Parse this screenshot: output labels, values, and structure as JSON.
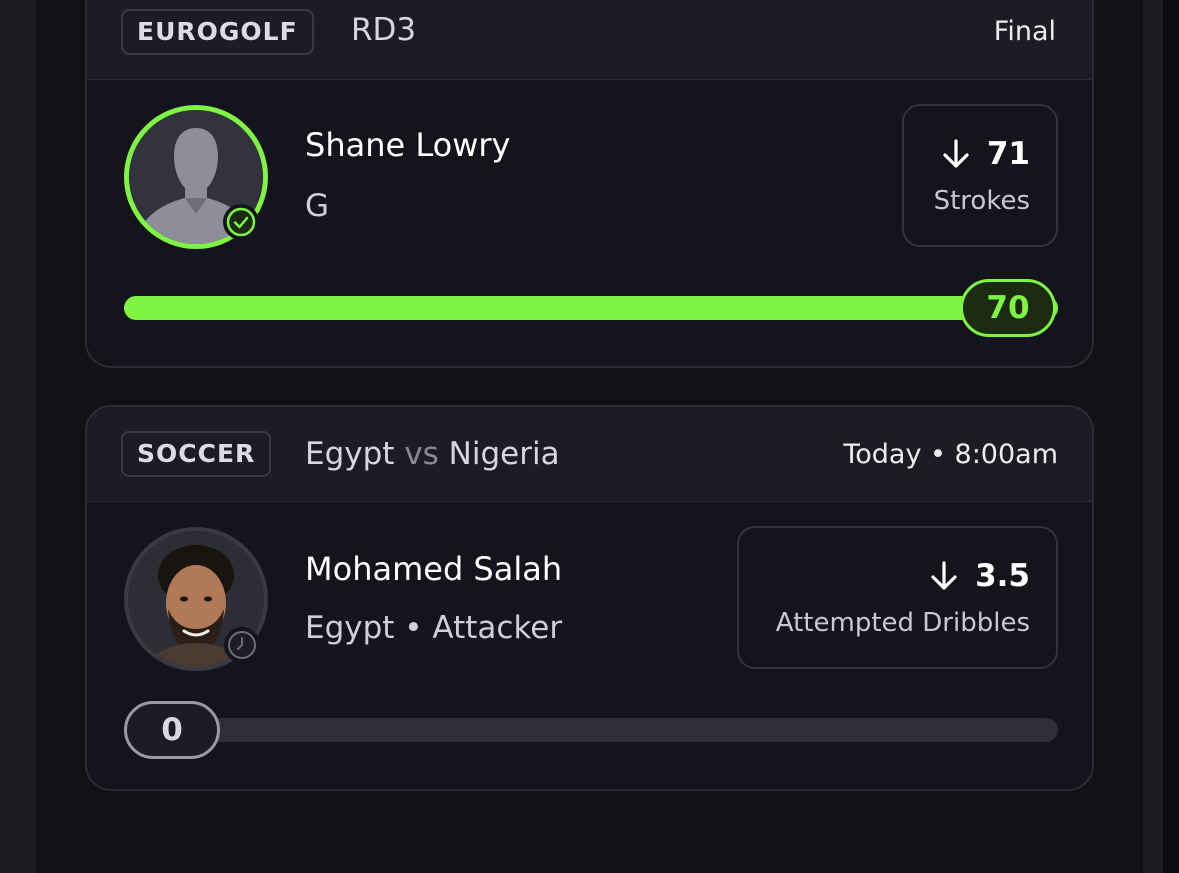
{
  "colors": {
    "accent": "#7ef542",
    "background": "#111118",
    "card": "#14141c",
    "header": "#1c1c25"
  },
  "cards": [
    {
      "sport_tag": "EUROGOLF",
      "round": "RD3",
      "status": "Final",
      "player": {
        "name": "Shane Lowry",
        "subtitle": "G",
        "avatar": "silhouette-avatar",
        "status_icon": "check-circle-icon"
      },
      "stat": {
        "direction_icon": "arrow-down-icon",
        "line": "71",
        "caption": "Strokes"
      },
      "progress": {
        "value": "70",
        "fraction": 1.0
      }
    },
    {
      "sport_tag": "SOCCER",
      "match": {
        "home": "Egypt",
        "vs": "vs",
        "away": "Nigeria"
      },
      "time": "Today • 8:00am",
      "player": {
        "name": "Mohamed Salah",
        "subtitle": "Egypt • Attacker",
        "avatar": "player-photo",
        "status_icon": "clock-icon"
      },
      "stat": {
        "direction_icon": "arrow-down-icon",
        "line": "3.5",
        "caption": "Attempted Dribbles"
      },
      "progress": {
        "value": "0",
        "fraction": 0
      }
    }
  ]
}
